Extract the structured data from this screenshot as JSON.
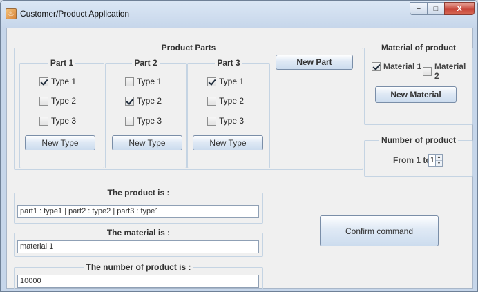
{
  "window": {
    "title": "Customer/Product Application",
    "minimize": "−",
    "maximize": "□",
    "close": "X"
  },
  "product_parts": {
    "title": "Product Parts",
    "parts": [
      {
        "title": "Part 1",
        "types": [
          {
            "label": "Type 1",
            "checked": true
          },
          {
            "label": "Type 2",
            "checked": false
          },
          {
            "label": "Type 3",
            "checked": false
          }
        ],
        "new_type_label": "New Type"
      },
      {
        "title": "Part 2",
        "types": [
          {
            "label": "Type 1",
            "checked": false
          },
          {
            "label": "Type 2",
            "checked": true
          },
          {
            "label": "Type 3",
            "checked": false
          }
        ],
        "new_type_label": "New Type"
      },
      {
        "title": "Part 3",
        "types": [
          {
            "label": "Type 1",
            "checked": true
          },
          {
            "label": "Type 2",
            "checked": false
          },
          {
            "label": "Type 3",
            "checked": false
          }
        ],
        "new_type_label": "New Type"
      }
    ],
    "new_part_label": "New Part"
  },
  "material": {
    "title": "Material of product",
    "options": [
      {
        "label": "Material 1",
        "checked": true
      },
      {
        "label": "Material 2",
        "checked": false
      }
    ],
    "new_material_label": "New Material"
  },
  "number": {
    "title": "Number of product",
    "prefix": "From 1 to",
    "value": "1",
    "up": "▲",
    "down": "▼"
  },
  "summary": {
    "product_title": "The product is :",
    "product_value": "part1 : type1 | part2 : type2 | part3 : type1",
    "material_title": "The material is :",
    "material_value": "material 1",
    "number_title": "The number of product is :",
    "number_value": "10000"
  },
  "confirm_label": "Confirm command"
}
